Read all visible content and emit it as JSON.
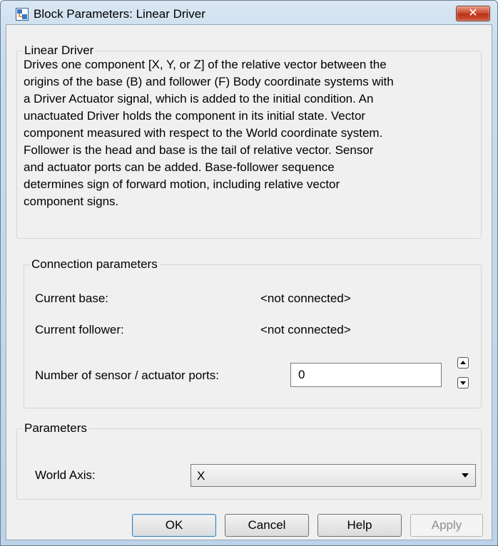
{
  "window": {
    "title": "Block Parameters: Linear Driver",
    "close_glyph": "✕"
  },
  "block_group": {
    "legend": "Linear Driver",
    "description_lines": [
      "Drives one component [X, Y, or Z] of the relative vector between the",
      "origins of the base (B) and follower (F) Body coordinate systems with",
      "a Driver Actuator signal, which is added to the initial condition. An",
      "unactuated Driver holds the component in its initial state. Vector",
      "component measured with respect to the World coordinate system.",
      "Follower is the head and base is the tail of relative vector. Sensor",
      "and actuator ports can be added. Base-follower sequence",
      "determines sign of forward motion, including relative vector",
      "component signs."
    ]
  },
  "connection": {
    "legend": "Connection parameters",
    "current_base_label": "Current base:",
    "current_base_value": "<not connected>",
    "current_follower_label": "Current follower:",
    "current_follower_value": "<not connected>",
    "ports_label": "Number of sensor / actuator ports:",
    "ports_value": "0"
  },
  "parameters": {
    "legend": "Parameters",
    "world_axis_label": "World Axis:",
    "world_axis_value": "X"
  },
  "buttons": {
    "ok": "OK",
    "cancel": "Cancel",
    "help": "Help",
    "apply": "Apply"
  }
}
